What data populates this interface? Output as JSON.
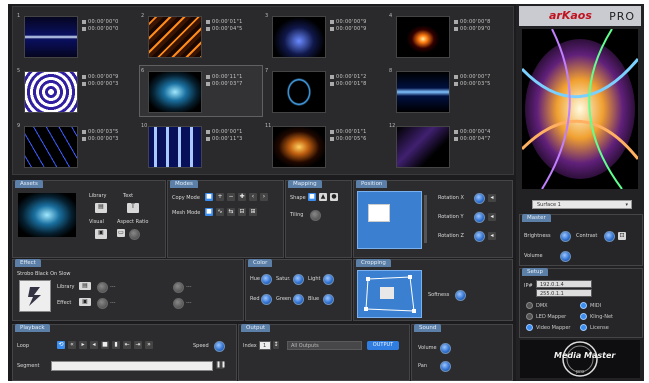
{
  "thumbs": [
    {
      "num": "1",
      "t1": "00:00'00\"0",
      "t2": "00:00'00\"0"
    },
    {
      "num": "2",
      "t1": "00:00'01\"1",
      "t2": "00:00'04\"5"
    },
    {
      "num": "3",
      "t1": "00:00'00\"9",
      "t2": "00:00'00\"9"
    },
    {
      "num": "4",
      "t1": "00:00'00\"8",
      "t2": "00:00'09\"0"
    },
    {
      "num": "5",
      "t1": "00:00'00\"9",
      "t2": "00:00'00\"3"
    },
    {
      "num": "6",
      "t1": "00:00'11\"1",
      "t2": "00:00'03\"7"
    },
    {
      "num": "7",
      "t1": "00:00'01\"2",
      "t2": "00:00'01\"8"
    },
    {
      "num": "8",
      "t1": "00:00'00\"7",
      "t2": "00:00'03\"5"
    },
    {
      "num": "9",
      "t1": "00:00'03\"5",
      "t2": "00:00'00\"3"
    },
    {
      "num": "10",
      "t1": "00:00'00\"1",
      "t2": "00:00'11\"3"
    },
    {
      "num": "11",
      "t1": "00:00'01\"1",
      "t2": "00:00'05\"6"
    },
    {
      "num": "12",
      "t1": "00:00'00\"4",
      "t2": "00:00'04\"7"
    }
  ],
  "panels": {
    "assets": {
      "title": "Assets",
      "library": "Library",
      "text": "Text",
      "visual": "Visual",
      "aspect": "Aspect Ratio"
    },
    "modes": {
      "title": "Modes",
      "copy": "Copy Mode",
      "mesh": "Mesh Mode"
    },
    "mapping": {
      "title": "Mapping",
      "shape": "Shape",
      "tiling": "Tiling"
    },
    "position": {
      "title": "Position",
      "rx": "Rotation X",
      "ry": "Rotation Y",
      "rz": "Rotation Z"
    },
    "effect": {
      "title": "Effect",
      "name": "Strobo Black On Slow",
      "library": "Library",
      "effect": "Effect",
      "dash1": "---",
      "dash2": "---",
      "dash3": "---",
      "dash4": "---"
    },
    "color": {
      "title": "Color",
      "hue": "Hue",
      "satur": "Satur.",
      "light": "Light",
      "red": "Red",
      "green": "Green",
      "blue": "Blue"
    },
    "cropping": {
      "title": "Cropping",
      "softness": "Softness"
    },
    "playback": {
      "title": "Playback",
      "loop": "Loop",
      "speed": "Speed",
      "segment": "Segment"
    },
    "output": {
      "title": "Output",
      "index": "Index",
      "value": "1",
      "field": "All Outputs",
      "button": "OUTPUT"
    },
    "sound": {
      "title": "Sound",
      "volume": "Volume",
      "pan": "Pan"
    }
  },
  "right": {
    "brand": "arKaos",
    "pro": "PRO",
    "surface": "Surface 1",
    "master": {
      "title": "Master",
      "brightness": "Brightness",
      "contrast": "Contrast",
      "volume": "Volume"
    },
    "setup": {
      "title": "Setup",
      "ip_label": "IP#",
      "ip": "192.0.1.4",
      "sub": "255.0.1.1",
      "dmx": "DMX",
      "midi": "MIDI",
      "led": "LED Mapper",
      "kling": "Kling-Net",
      "video": "Video Mapper",
      "license": "License"
    },
    "logo": "Media Master",
    "logo_sub": "pro"
  }
}
